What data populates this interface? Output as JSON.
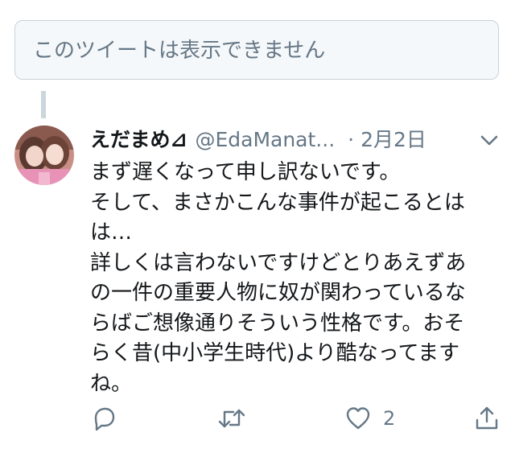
{
  "unavailable": {
    "text": "このツイートは表示できません"
  },
  "tweet": {
    "display_name": "えだまめ⊿",
    "handle": "@EdaManat...",
    "separator": "·",
    "date": "2月2日",
    "lines": [
      "まず遅くなって申し訳ないです。",
      "そして、まさかこんな事件が起こるとは",
      "は…",
      "詳しくは言わないですけどとりあえずあ",
      "の一件の重要人物に奴が関わっているな",
      "らばご想像通りそういう性格です。おそ",
      "らく昔(中小学生時代)より酷なってます",
      "ね。"
    ],
    "like_count": "2"
  },
  "icons": {
    "reply": "reply-icon",
    "retweet": "retweet-icon",
    "like": "heart-icon",
    "share": "share-icon",
    "menu": "chevron-down-icon"
  },
  "colors": {
    "text": "#14171a",
    "muted": "#657786",
    "box_bg": "#f5f8fa",
    "box_border": "#c8d2da",
    "thread_line": "#ccd6dd"
  }
}
